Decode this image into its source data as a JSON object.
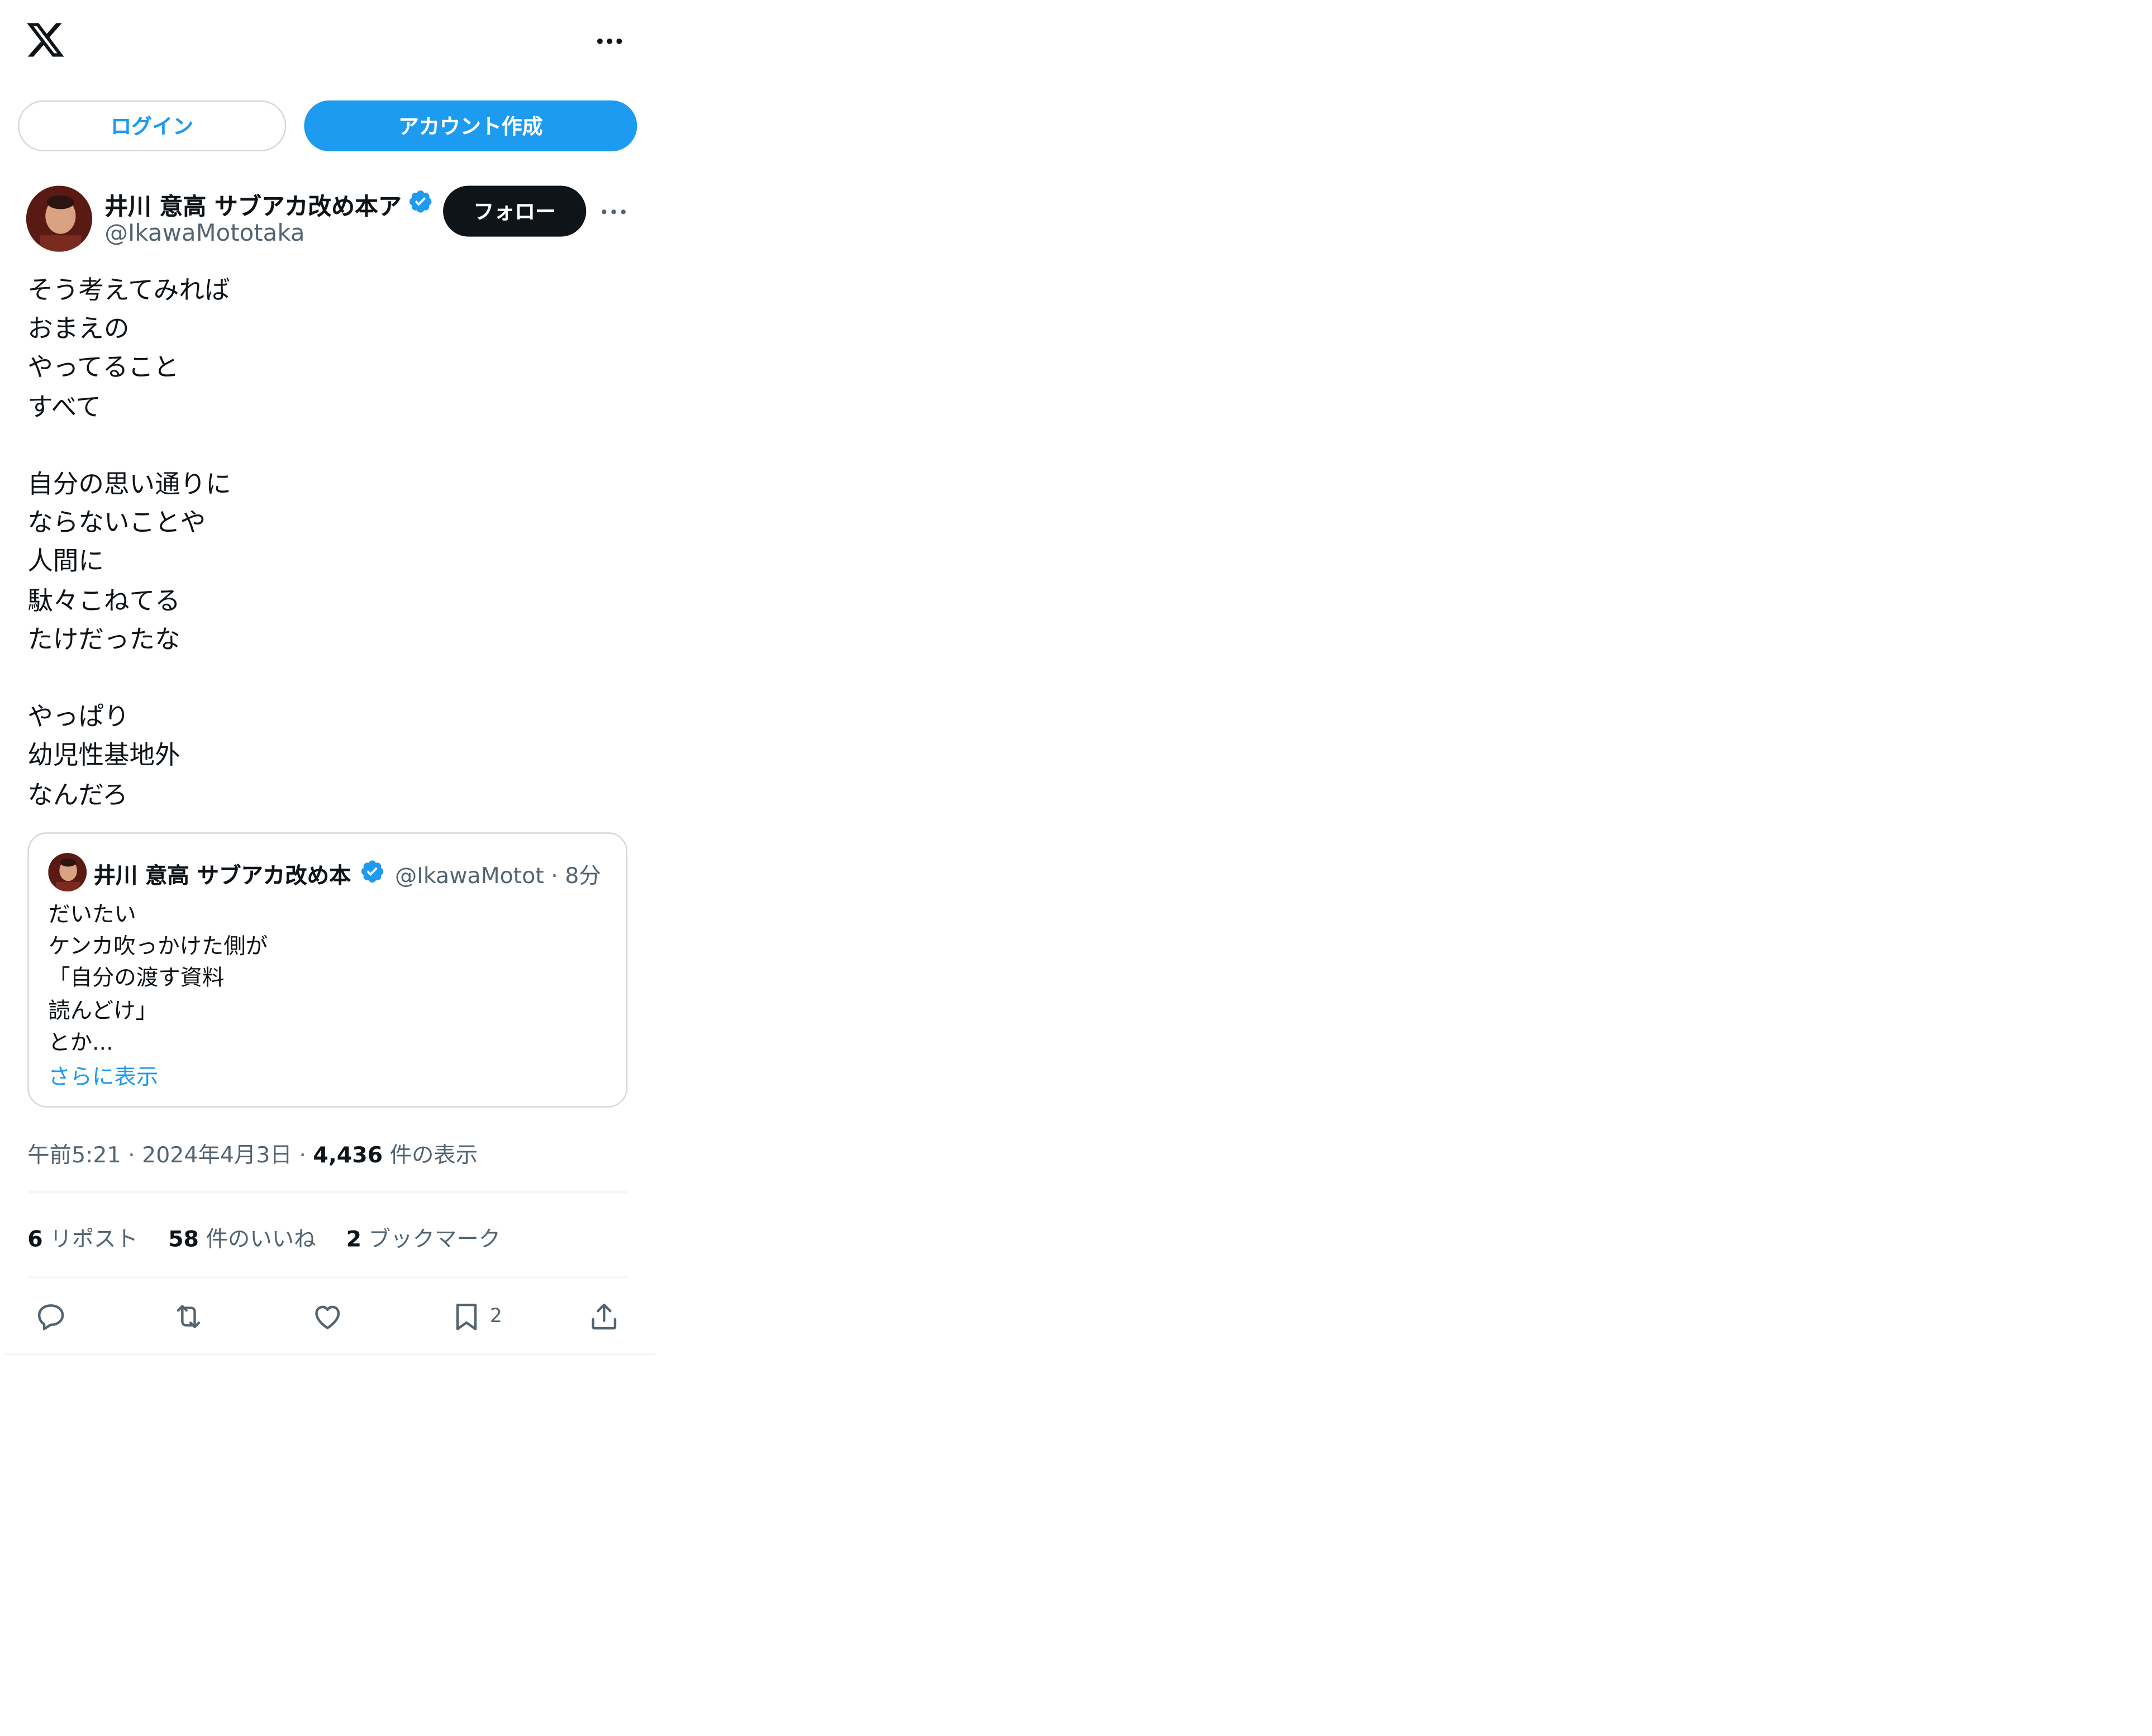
{
  "header": {
    "logo_icon": "x-logo-icon",
    "more_icon": "more-horizontal-icon"
  },
  "auth": {
    "login_label": "ログイン",
    "signup_label": "アカウント作成"
  },
  "tweet": {
    "author_name": "井川 意高 サブアカ改め本ア",
    "verified_icon": "verified-badge-icon",
    "handle": "@IkawaMototaka",
    "follow_label": "フォロー",
    "text": "そう考えてみれば\nおまえの\nやってること\nすべて\n\n自分の思い通りに\nならないことや\n人間に\n駄々こねてる\nたけだったな\n\nやっぱり\n幼児性基地外\nなんだろ",
    "quote": {
      "author_name": "井川 意高 サブアカ改め本",
      "handle_time": "@IkawaMotot · 8分",
      "text": "だいたい\nケンカ吹っかけた側が\n「自分の渡す資料\n読んどけ」\nとか...",
      "show_more": "さらに表示"
    },
    "meta_time": "午前5:21 · 2024年4月3日 · ",
    "meta_views": "4,436",
    "meta_views_label": " 件の表示",
    "stats": {
      "reposts": "6",
      "reposts_label": " リポスト",
      "likes": "58",
      "likes_label": " 件のいいね",
      "bookmarks": "2",
      "bookmarks_label": " ブックマーク"
    },
    "actions": {
      "reply_icon": "reply-icon",
      "retweet_icon": "retweet-icon",
      "like_icon": "heart-icon",
      "bookmark_icon": "bookmark-icon",
      "bookmark_count": "2",
      "share_icon": "share-icon"
    }
  },
  "colors": {
    "accent": "#1d9bf0",
    "text": "#0f1419",
    "muted": "#536471",
    "border": "#cfd9de"
  }
}
